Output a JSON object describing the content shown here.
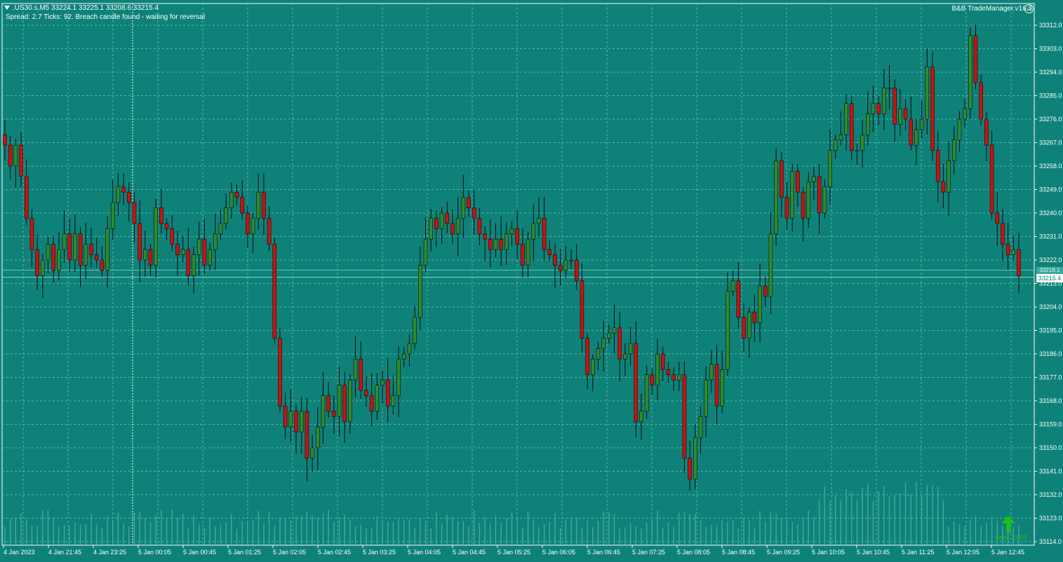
{
  "window": {
    "symbol_line": ".US30.s,M5  33224.1 33225.1 33208.6 33215.4",
    "status_line": "Spread: 2.7   Ticks: 92.  Breach candle found - waiting for reversal",
    "ea_name": "B&B TradeManager.v16.3"
  },
  "price_axis": {
    "labels": [
      "33312.0",
      "33303.0",
      "33294.0",
      "33285.0",
      "33276.0",
      "33267.0",
      "33258.0",
      "33249.0",
      "33240.0",
      "33231.0",
      "33222.0",
      "33213.0",
      "33204.0",
      "33195.0",
      "33186.0",
      "33177.0",
      "33168.0",
      "33159.0",
      "33150.0",
      "33141.0",
      "33132.0",
      "33123.0",
      "33114.0"
    ],
    "current_price": "33215.4",
    "secondary_price": "33218.1"
  },
  "time_axis": {
    "labels": [
      "4 Jan 2023",
      "4 Jan 21:45",
      "4 Jan 23:25",
      "5 Jan 00:05",
      "5 Jan 00:45",
      "5 Jan 01:25",
      "5 Jan 02:05",
      "5 Jan 02:45",
      "5 Jan 03:25",
      "5 Jan 04:05",
      "5 Jan 04:45",
      "5 Jan 05:25",
      "5 Jan 06:05",
      "5 Jan 06:45",
      "5 Jan 07:25",
      "5 Jan 08:05",
      "5 Jan 08:45",
      "5 Jan 09:25",
      "5 Jan 10:05",
      "5 Jan 10:45",
      "5 Jan 11:25",
      "5 Jan 12:05",
      "5 Jan 12:45"
    ]
  },
  "timer": {
    "label": "5min 13:05"
  },
  "colors": {
    "background": "#0e8279",
    "bull": "#2e8b2e",
    "bear": "#cc1111",
    "grid": "#5fb3ab",
    "text": "#ffffff"
  },
  "chart_data": {
    "type": "candlestick",
    "ylim": [
      33112,
      33314
    ],
    "closes": [
      33266,
      33258,
      33266,
      33254,
      33238,
      33226,
      33216,
      33222,
      33228,
      33218,
      33226,
      33232,
      33222,
      33232,
      33220,
      33228,
      33224,
      33222,
      33218,
      33234,
      33244,
      33250,
      33248,
      33244,
      33236,
      33222,
      33226,
      33220,
      33242,
      33236,
      33234,
      33228,
      33224,
      33226,
      33216,
      33224,
      33230,
      33220,
      33226,
      33232,
      33236,
      33242,
      33248,
      33246,
      33240,
      33232,
      33238,
      33248,
      33238,
      33228,
      33192,
      33166,
      33158,
      33164,
      33156,
      33164,
      33146,
      33150,
      33158,
      33170,
      33164,
      33162,
      33174,
      33160,
      33176,
      33184,
      33172,
      33170,
      33164,
      33174,
      33176,
      33166,
      33170,
      33184,
      33186,
      33190,
      33200,
      33220,
      33230,
      33238,
      33234,
      33240,
      33236,
      33232,
      33238,
      33246,
      33242,
      33238,
      33232,
      33230,
      33226,
      33230,
      33226,
      33232,
      33234,
      33228,
      33220,
      33230,
      33236,
      33238,
      33226,
      33224,
      33220,
      33218,
      33222,
      33222,
      33214,
      33192,
      33178,
      33184,
      33188,
      33192,
      33194,
      33196,
      33184,
      33186,
      33190,
      33160,
      33164,
      33178,
      33174,
      33186,
      33180,
      33178,
      33176,
      33178,
      33146,
      33138,
      33154,
      33162,
      33176,
      33182,
      33166,
      33180,
      33210,
      33214,
      33200,
      33192,
      33202,
      33198,
      33212,
      33208,
      33232,
      33260,
      33246,
      33238,
      33256,
      33248,
      33238,
      33252,
      33254,
      33240,
      33250,
      33264,
      33268,
      33270,
      33282,
      33264,
      33264,
      33270,
      33278,
      33282,
      33278,
      33288,
      33288,
      33274,
      33280,
      33276,
      33266,
      33272,
      33276,
      33296,
      33264,
      33252,
      33248,
      33260,
      33268,
      33276,
      33280,
      33308,
      33290,
      33276,
      33266,
      33240,
      33236,
      33228,
      33224,
      33226,
      33216
    ],
    "candles_note": "open/high/low per candle derived in script rendering order"
  }
}
